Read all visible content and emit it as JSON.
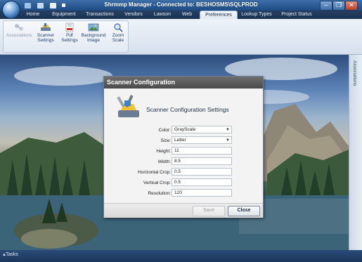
{
  "window": {
    "title": "Shrmmp Manager - Connected to: BESHOSMS\\SQLPROD",
    "minimize": "–",
    "restore": "❐",
    "close": "✕"
  },
  "tabs": [
    "Home",
    "Equipment",
    "Transactions",
    "Vendors",
    "Lawson",
    "Web",
    "Preferences",
    "Lookup Types",
    "Project Status"
  ],
  "active_tab": "Preferences",
  "ribbon": {
    "buttons": [
      {
        "label": "Associations",
        "icon": "associations-icon",
        "enabled": false
      },
      {
        "label": "Scanner\nSettings",
        "icon": "scanner-icon",
        "enabled": true
      },
      {
        "label": "Pdf\nSettings",
        "icon": "pdf-icon",
        "enabled": true
      },
      {
        "label": "Background\nImage",
        "icon": "image-icon",
        "enabled": true
      },
      {
        "label": "Zoom\nScale",
        "icon": "zoom-icon",
        "enabled": true
      }
    ]
  },
  "side_panel": {
    "label": "Associations"
  },
  "status": {
    "tasks": "Tasks"
  },
  "dialog": {
    "title": "Scanner Configuration",
    "heading": "Scanner Configuration Settings",
    "fields": [
      {
        "label": "Color:",
        "value": "GrayScale",
        "type": "select"
      },
      {
        "label": "Size:",
        "value": "Letter",
        "type": "select"
      },
      {
        "label": "Height:",
        "value": "11",
        "type": "text"
      },
      {
        "label": "Width:",
        "value": "8.5",
        "type": "text"
      },
      {
        "label": "Horizontal Crop:",
        "value": "0.5",
        "type": "text"
      },
      {
        "label": "Vertical Crop:",
        "value": "0.5",
        "type": "text"
      },
      {
        "label": "Resolution:",
        "value": "120",
        "type": "text"
      }
    ],
    "save_label": "Save",
    "close_label": "Close"
  }
}
